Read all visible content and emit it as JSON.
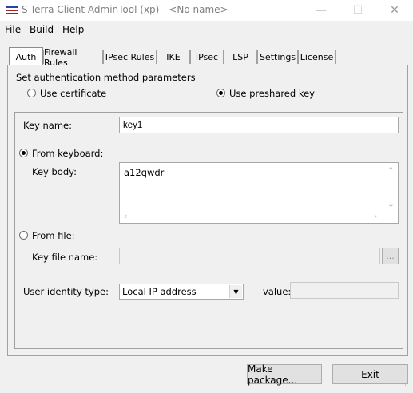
{
  "window": {
    "title": "S-Terra Client AdminTool (xp) - <No name>",
    "minimize_glyph": "—",
    "maximize_glyph": "☐",
    "close_glyph": "✕"
  },
  "menu": [
    "File",
    "Build",
    "Help"
  ],
  "tabs": [
    "Auth",
    "Firewall Rules",
    "IPsec Rules",
    "IKE",
    "IPsec",
    "LSP",
    "Settings",
    "License"
  ],
  "active_tab": "Auth",
  "auth": {
    "section_label": "Set authentication method parameters",
    "use_certificate_label": "Use certificate",
    "use_preshared_label": "Use preshared key",
    "selected_method": "preshared",
    "key_name_label": "Key name:",
    "key_name_value": "key1",
    "from_keyboard_label": "From keyboard:",
    "from_keyboard_selected": true,
    "key_body_label": "Key body:",
    "key_body_value": "a12qwdr",
    "from_file_label": "From file:",
    "key_file_name_label": "Key file name:",
    "key_file_name_value": "",
    "browse_label": "...",
    "user_identity_label": "User identity type:",
    "user_identity_value": "Local IP address",
    "value_label": "value:",
    "value_value": ""
  },
  "buttons": {
    "make_package": "Make package...",
    "exit": "Exit"
  }
}
